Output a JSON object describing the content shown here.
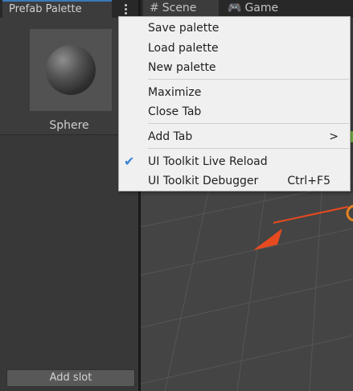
{
  "left_panel": {
    "tab_label": "Prefab Palette",
    "item_label": "Sphere",
    "add_slot_label": "Add slot"
  },
  "right_panel": {
    "tabs": [
      {
        "icon": "scene-grid-icon",
        "glyph": "#",
        "label": "Scene"
      },
      {
        "icon": "game-controller-icon",
        "glyph": "🎮",
        "label": "Game"
      }
    ]
  },
  "context_menu": {
    "items": [
      {
        "label": "Save palette"
      },
      {
        "label": "Load palette"
      },
      {
        "label": "New palette"
      },
      {
        "label": "Maximize"
      },
      {
        "label": "Close Tab"
      },
      {
        "label": "Add Tab",
        "submenu_glyph": ">"
      },
      {
        "label": "UI Toolkit Live Reload",
        "check_glyph": "✔",
        "checked": true
      },
      {
        "label": "UI Toolkit Debugger",
        "shortcut": "Ctrl+F5"
      }
    ]
  },
  "colors": {
    "accent": "#3a79bb",
    "check": "#3b82d6",
    "gizmo_arrow": "#e84a1f"
  }
}
